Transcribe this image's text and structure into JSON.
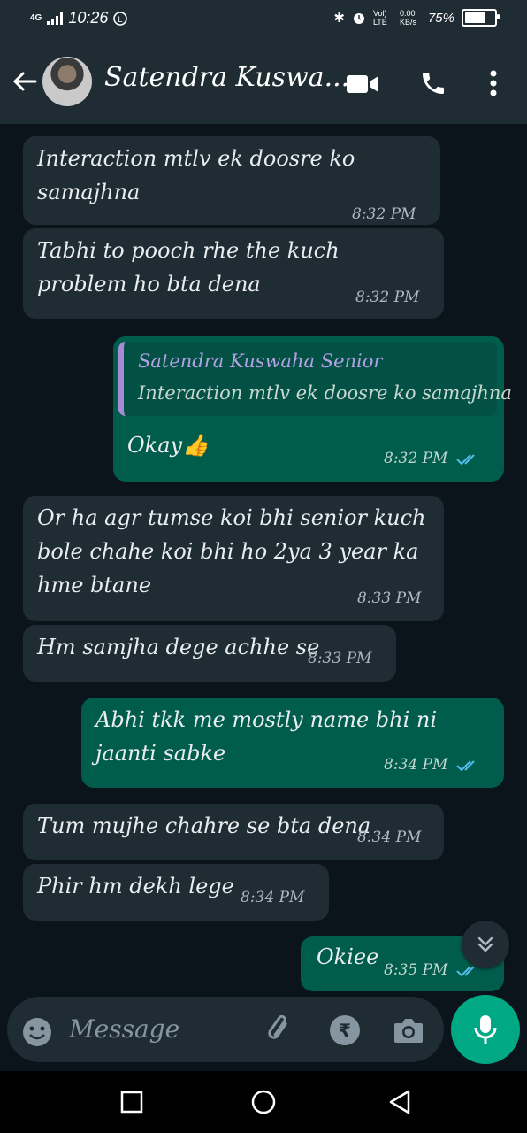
{
  "status_bar": {
    "network": "4G",
    "time": "10:26",
    "volte": "Vol) LTE",
    "data_speed": "0.00 KB/s",
    "battery_text": "75%",
    "battery_level": 0.75
  },
  "header": {
    "contact_name": "Satendra Kuswa..."
  },
  "messages": [
    {
      "type": "incoming",
      "text": "Interaction mtlv ek doosre ko samajhna",
      "time": "8:32 PM"
    },
    {
      "type": "incoming",
      "text": "Tabhi to pooch rhe the kuch problem ho bta dena",
      "time": "8:32 PM"
    },
    {
      "type": "outgoing",
      "quote_name": "Satendra Kuswaha Senior",
      "quote_text": "Interaction mtlv ek doosre ko samajhna",
      "text": "Okay👍",
      "time": "8:32 PM"
    },
    {
      "type": "incoming",
      "text": "Or ha agr tumse koi bhi senior kuch bole chahe koi bhi ho 2ya 3 year ka hme btane",
      "time": "8:33 PM"
    },
    {
      "type": "incoming",
      "text": "Hm samjha dege achhe se",
      "time": "8:33 PM"
    },
    {
      "type": "outgoing",
      "text": "Abhi tkk me mostly name bhi ni jaanti sabke",
      "time": "8:34 PM"
    },
    {
      "type": "incoming",
      "text": "Tum mujhe chahre se bta dena",
      "time": "8:34 PM"
    },
    {
      "type": "incoming",
      "text": "Phir hm dekh lege",
      "time": "8:34 PM"
    },
    {
      "type": "outgoing",
      "text": "Okiee",
      "time": "8:35 PM"
    }
  ],
  "input": {
    "placeholder": "Message"
  },
  "colors": {
    "incoming_bubble": "#1f2c33",
    "outgoing_bubble": "#005c4b",
    "accent": "#00a884",
    "read_tick": "#53bdeb"
  }
}
